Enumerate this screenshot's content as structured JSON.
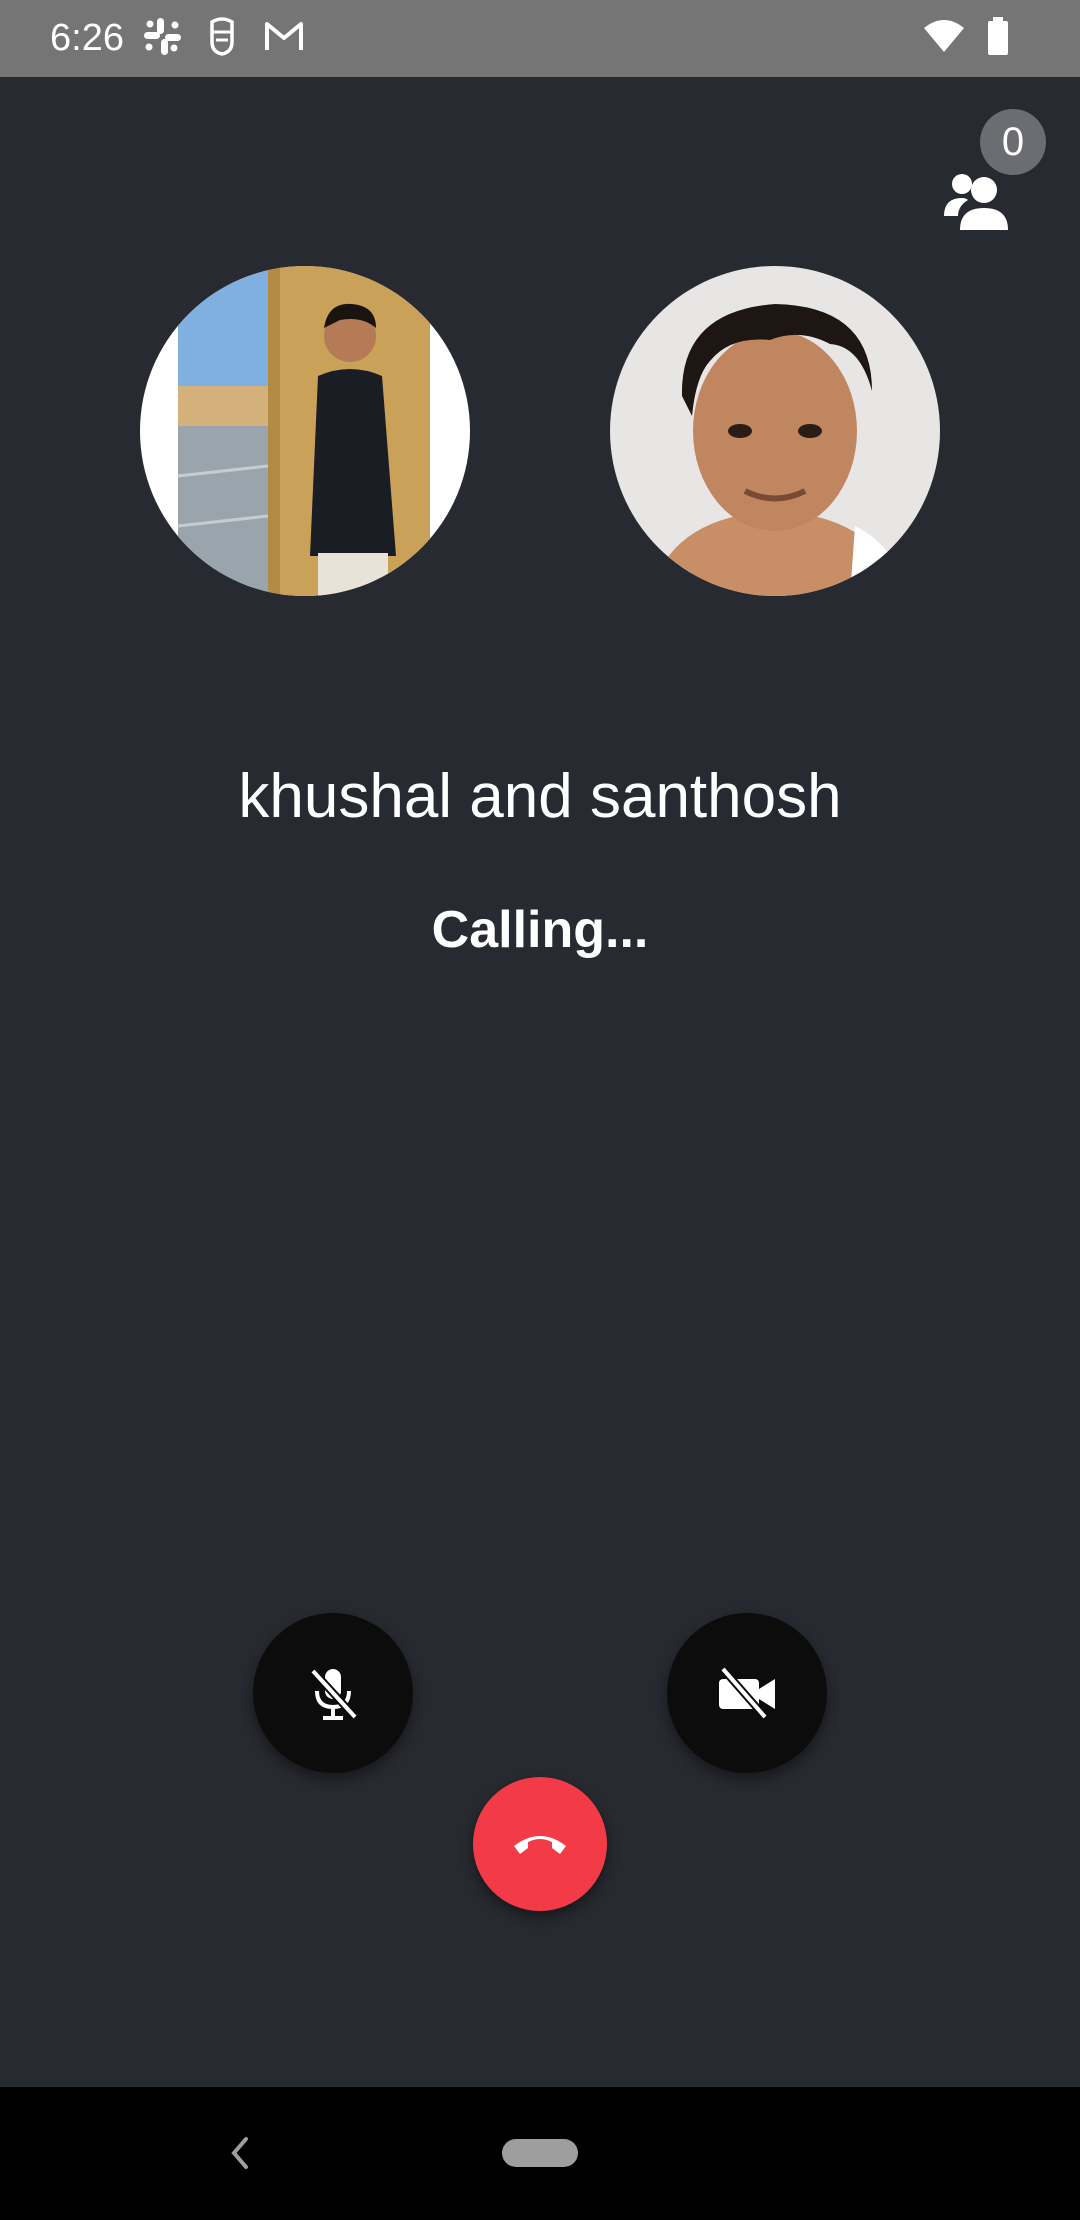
{
  "status_bar": {
    "time": "6:26",
    "notification_icons": [
      "slack-icon",
      "bitmoji-icon",
      "gmail-icon"
    ],
    "system_icons": [
      "wifi-icon",
      "battery-icon"
    ]
  },
  "call": {
    "participants_count": "0",
    "callee_names": "khushal and santhosh",
    "status": "Calling...",
    "avatars": [
      {
        "person": "khushal"
      },
      {
        "person": "santhosh"
      }
    ]
  },
  "controls": {
    "mute_icon": "microphone-off-icon",
    "video_icon": "video-off-icon",
    "end_icon": "hang-up-icon"
  },
  "colors": {
    "background": "#282a31",
    "end_call": "#f23b46",
    "control_button": "#0c0c0d",
    "status_bar": "#757575"
  }
}
